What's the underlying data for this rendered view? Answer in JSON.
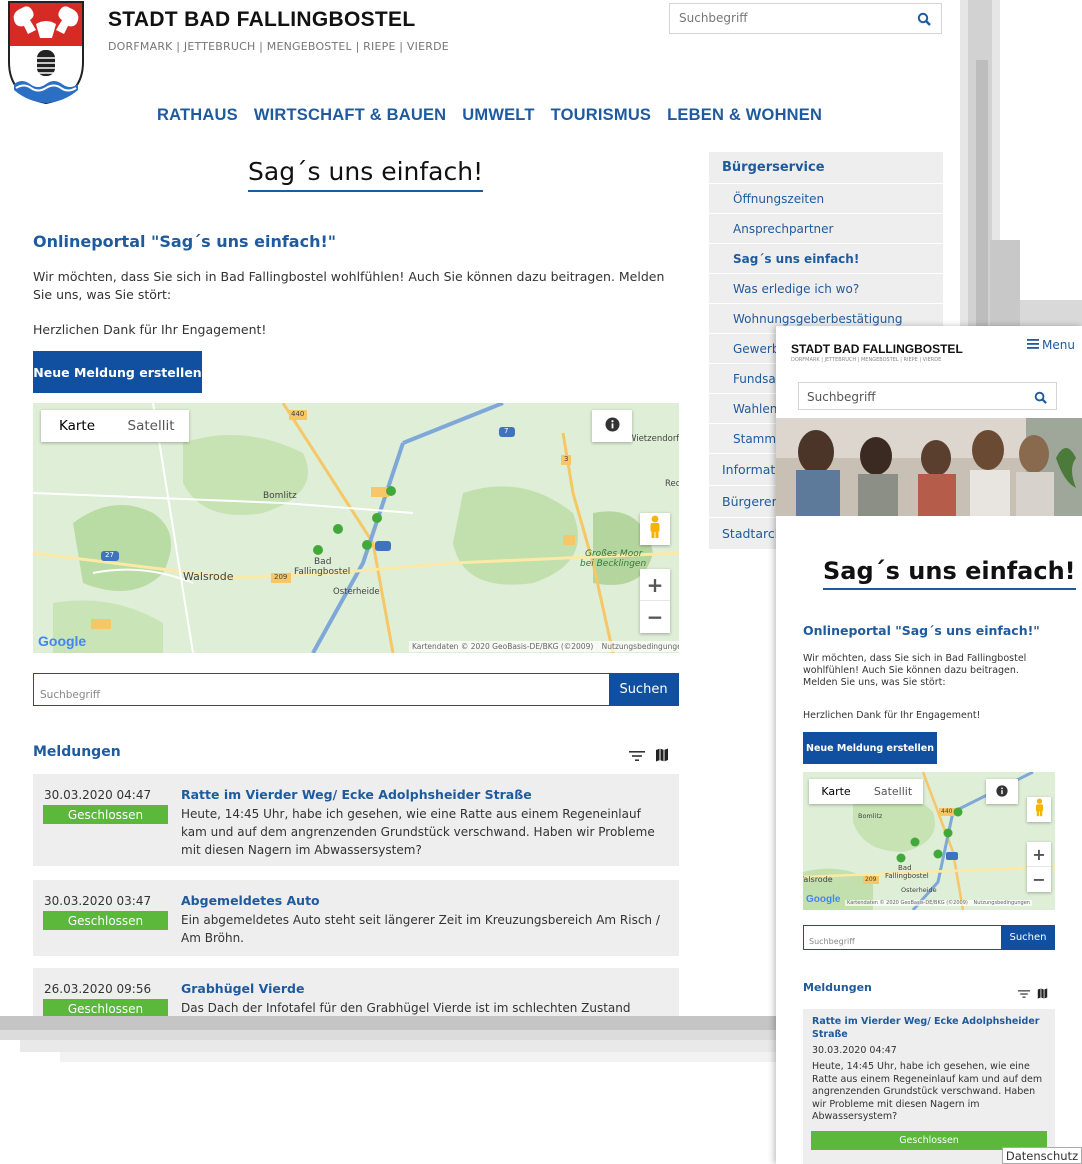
{
  "site": {
    "title": "STADT BAD FALLINGBOSTEL",
    "subtitle": "DORFMARK | JETTEBRUCH | MENGEBOSTEL | RIEPE | VIERDE"
  },
  "search": {
    "placeholder": "Suchbegriff",
    "icon": "search-icon"
  },
  "nav": [
    "RATHAUS",
    "WIRTSCHAFT & BAUEN",
    "UMWELT",
    "TOURISMUS",
    "LEBEN & WOHNEN"
  ],
  "page": {
    "title": "Sag´s uns einfach!",
    "portal_heading": "Onlineportal \"Sag´s uns einfach!\"",
    "intro": "Wir möchten, dass Sie sich in Bad Fallingbostel wohlfühlen! Auch Sie können dazu beitragen. Melden Sie uns, was Sie stört:",
    "thanks": "Herzlichen Dank für Ihr Engagement!",
    "new_report_button": "Neue Meldung erstellen"
  },
  "map": {
    "tab_map": "Karte",
    "tab_satellite": "Satellit",
    "zoom_in": "+",
    "zoom_out": "−",
    "google": "Google",
    "attribution": "Kartendaten © 2020 GeoBasis-DE/BKG (©2009)",
    "terms": "Nutzungsbedingungen",
    "places": {
      "bomlitz": "Bomlitz",
      "walsrode": "Walsrode",
      "bad": "Bad",
      "fallingbostel": "Fallingbostel",
      "osterheide": "Osterheide",
      "wietzendorf": "Wietzendorf",
      "red": "Red",
      "moor1": "Großes Moor",
      "moor2": "bei Becklingen"
    },
    "roads": {
      "r440": "440",
      "r7": "7",
      "r3": "3",
      "r27": "27",
      "r209": "209"
    }
  },
  "filter": {
    "placeholder": "Suchbegriff",
    "button": "Suchen"
  },
  "reports": {
    "heading": "Meldungen",
    "items": [
      {
        "date": "30.03.2020 04:47",
        "status": "Geschlossen",
        "title": "Ratte im Vierder Weg/ Ecke Adolphsheider Straße",
        "text": "Heute, 14:45 Uhr, habe ich gesehen, wie eine Ratte aus einem Regeneinlauf kam und auf dem angrenzenden Grundstück verschwand. Haben wir Probleme mit diesen Nagern im Abwassersystem?"
      },
      {
        "date": "30.03.2020 03:47",
        "status": "Geschlossen",
        "title": "Abgemeldetes Auto",
        "text": "Ein abgemeldetes Auto steht seit längerer Zeit im Kreuzungsbereich Am Risch / Am Bröhn."
      },
      {
        "date": "26.03.2020 09:56",
        "status": "Geschlossen",
        "title": "Grabhügel Vierde",
        "text": "Das Dach der Infotafel für den Grabhügel Vierde ist im schlechten Zustand"
      }
    ]
  },
  "sidebar": {
    "heading": "Bürgerservice",
    "items": [
      "Öffnungszeiten",
      "Ansprechpartner",
      "Sag´s uns einfach!",
      "Was erledige ich wo?",
      "Wohnungsgeberbestätigung",
      "Gewerbe",
      "Fundsachen",
      "Wahlen",
      "Stammtisch"
    ],
    "top_items": [
      "Informationen",
      "Bürgerentscheid",
      "Stadtarchiv"
    ]
  },
  "mobile": {
    "menu": "Menu",
    "menu_icon": "hamburger-icon"
  },
  "footer": {
    "privacy": "Datenschutz"
  },
  "colors": {
    "brand_blue": "#1e5a9e",
    "button_blue": "#1150a0",
    "status_green": "#5cb83a",
    "panel_gray": "#eeeeee"
  }
}
